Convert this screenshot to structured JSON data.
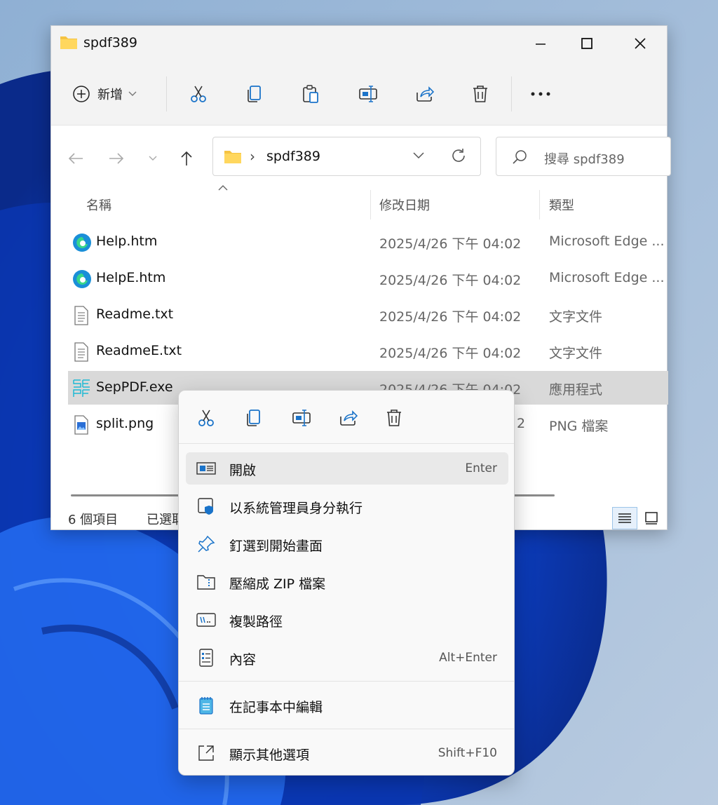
{
  "window": {
    "title": "spdf389"
  },
  "toolbar": {
    "new_label": "新增",
    "icons": [
      "cut-icon",
      "copy-icon",
      "paste-icon",
      "rename-icon",
      "share-icon",
      "delete-icon",
      "more-icon"
    ]
  },
  "nav": {
    "path_segment": "spdf389",
    "search_placeholder": "搜尋 spdf389"
  },
  "columns": {
    "name": "名稱",
    "modified": "修改日期",
    "type": "類型"
  },
  "files": [
    {
      "name": "Help.htm",
      "modified": "2025/4/26 下午 04:02",
      "type": "Microsoft Edge ...",
      "icon": "edge-icon"
    },
    {
      "name": "HelpE.htm",
      "modified": "2025/4/26 下午 04:02",
      "type": "Microsoft Edge ...",
      "icon": "edge-icon"
    },
    {
      "name": "Readme.txt",
      "modified": "2025/4/26 下午 04:02",
      "type": "文字文件",
      "icon": "text-file-icon"
    },
    {
      "name": "ReadmeE.txt",
      "modified": "2025/4/26 下午 04:02",
      "type": "文字文件",
      "icon": "text-file-icon"
    },
    {
      "name": "SepPDF.exe",
      "modified": "2025/4/26 下午 04:02",
      "type": "應用程式",
      "icon": "seppdf-app-icon",
      "selected": true
    },
    {
      "name": "split.png",
      "modified": "2",
      "type": "PNG 檔案",
      "icon": "image-file-icon"
    }
  ],
  "status": {
    "count": "6 個項目",
    "selected": "已選取"
  },
  "context_menu": {
    "quick_icons": [
      "cut-icon",
      "copy-icon",
      "rename-icon",
      "share-icon",
      "delete-icon"
    ],
    "items": [
      {
        "label": "開啟",
        "shortcut": "Enter",
        "icon": "open-icon"
      },
      {
        "label": "以系統管理員身分執行",
        "shortcut": "",
        "icon": "admin-shield-icon"
      },
      {
        "label": "釘選到開始畫面",
        "shortcut": "",
        "icon": "pin-icon"
      },
      {
        "label": "壓縮成 ZIP 檔案",
        "shortcut": "",
        "icon": "zip-folder-icon"
      },
      {
        "label": "複製路徑",
        "shortcut": "",
        "icon": "copy-path-icon"
      },
      {
        "label": "內容",
        "shortcut": "Alt+Enter",
        "icon": "properties-icon"
      },
      {
        "label": "在記事本中編輯",
        "shortcut": "",
        "icon": "notepad-icon"
      },
      {
        "label": "顯示其他選項",
        "shortcut": "Shift+F10",
        "icon": "more-options-icon"
      }
    ]
  },
  "colors": {
    "accent": "#0067c0",
    "selection": "#d9d9d9",
    "wallpaper_blue": "#1a4fd8"
  }
}
